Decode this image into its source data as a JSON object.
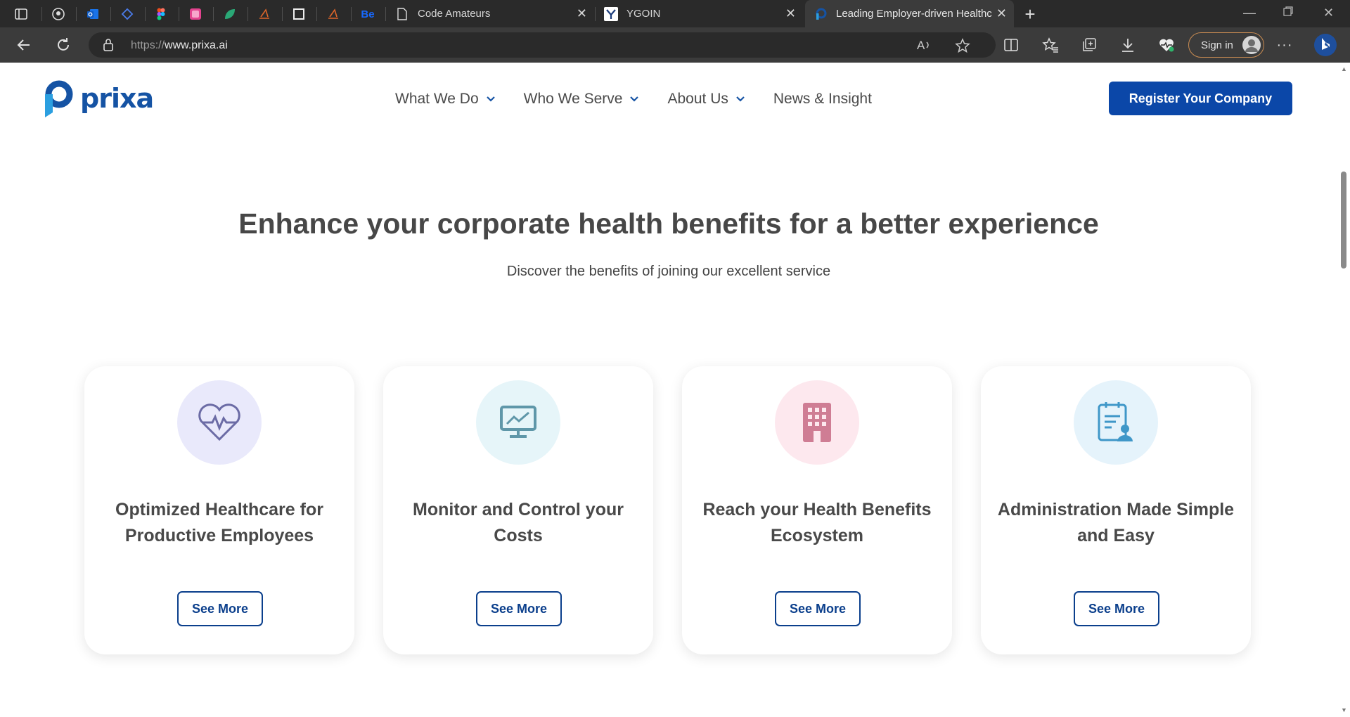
{
  "browser": {
    "tabs": [
      {
        "label": "Code Amateurs",
        "icon": "document-icon"
      },
      {
        "label": "YGOIN",
        "icon": "ygoin-favicon"
      },
      {
        "label": "Leading Employer-driven Healthc",
        "icon": "prixa-favicon",
        "active": true
      }
    ],
    "pinned_tabs": [
      "tab-actions-icon",
      "github-icon",
      "outlook-icon",
      "diamond-icon",
      "figma-icon",
      "pink-square-icon",
      "leaf-icon",
      "sketch-icon",
      "square-icon",
      "sketch-icon-2",
      "behance-icon"
    ],
    "url_scheme": "https://",
    "url_host": "www.prixa.ai",
    "signin_label": "Sign in"
  },
  "site": {
    "logo_text": "prixa",
    "nav": [
      {
        "label": "What We Do",
        "dropdown": true
      },
      {
        "label": "Who We Serve",
        "dropdown": true
      },
      {
        "label": "About Us",
        "dropdown": true
      },
      {
        "label": "News & Insight",
        "dropdown": false
      }
    ],
    "register_label": "Register Your Company",
    "hero_title": "Enhance your corporate health benefits for a better experience",
    "hero_subtitle": "Discover the benefits of joining our excellent service",
    "cards": [
      {
        "title": "Optimized Healthcare for Productive Employees",
        "button": "See More",
        "icon": "heartbeat-icon",
        "bg": "#e9e9fb",
        "color": "#6b6ba5"
      },
      {
        "title": "Monitor and Control your Costs",
        "button": "See More",
        "icon": "monitor-chart-icon",
        "bg": "#e6f5f9",
        "color": "#5f97a9"
      },
      {
        "title": "Reach your Health Benefits Ecosystem",
        "button": "See More",
        "icon": "building-icon",
        "bg": "#fde8ee",
        "color": "#cf7d94"
      },
      {
        "title": "Administration Made Simple and Easy",
        "button": "See More",
        "icon": "clipboard-user-icon",
        "bg": "#e5f3fb",
        "color": "#3f97c8"
      }
    ]
  },
  "colors": {
    "brand": "#1553a4",
    "primary_button": "#0b47a8",
    "outline_button": "#0b3f8c"
  }
}
